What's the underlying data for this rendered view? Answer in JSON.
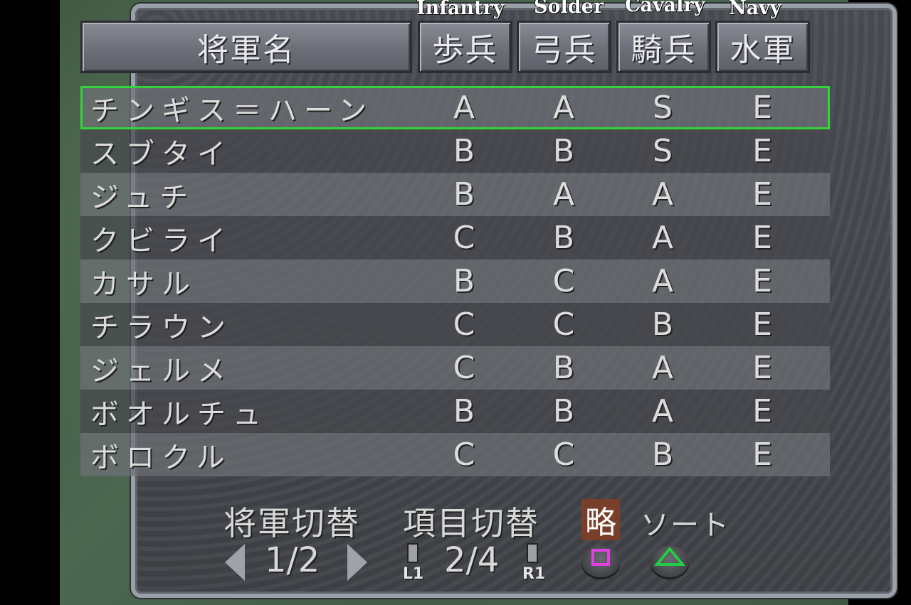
{
  "header": {
    "name_col": "将軍名",
    "columns": [
      {
        "kanji": "歩兵",
        "label": "Infantry"
      },
      {
        "kanji": "弓兵",
        "label": "Solder"
      },
      {
        "kanji": "騎兵",
        "label": "Cavalry"
      },
      {
        "kanji": "水軍",
        "label": "Navy"
      }
    ]
  },
  "rows": [
    {
      "name": "チンギス＝ハーン",
      "grades": [
        "A",
        "A",
        "S",
        "E"
      ]
    },
    {
      "name": "スブタイ",
      "grades": [
        "B",
        "B",
        "S",
        "E"
      ]
    },
    {
      "name": "ジュチ",
      "grades": [
        "B",
        "A",
        "A",
        "E"
      ]
    },
    {
      "name": "クビライ",
      "grades": [
        "C",
        "B",
        "A",
        "E"
      ]
    },
    {
      "name": "カサル",
      "grades": [
        "B",
        "C",
        "A",
        "E"
      ]
    },
    {
      "name": "チラウン",
      "grades": [
        "C",
        "C",
        "B",
        "E"
      ]
    },
    {
      "name": "ジェルメ",
      "grades": [
        "C",
        "B",
        "A",
        "E"
      ]
    },
    {
      "name": "ボオルチュ",
      "grades": [
        "B",
        "B",
        "A",
        "E"
      ]
    },
    {
      "name": "ボロクル",
      "grades": [
        "C",
        "C",
        "B",
        "E"
      ]
    }
  ],
  "footer": {
    "general_switch": "将軍切替",
    "item_switch": "項目切替",
    "ryaku": "略",
    "sort": "ソート",
    "page": "1/2",
    "item_page": "2/4",
    "l1": "L1",
    "r1": "R1"
  },
  "colors": {
    "selection": "#33d43a",
    "square_button": "#e040e0",
    "triangle_button": "#22cc44"
  }
}
